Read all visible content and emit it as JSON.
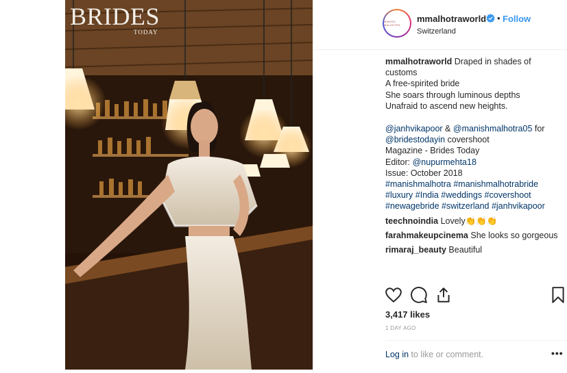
{
  "brand": {
    "title": "BRIDES",
    "subtitle": "TODAY"
  },
  "header": {
    "avatar_text": "MANISH MALHOTRA",
    "username": "mmalhotraworld",
    "dot": "•",
    "follow_label": "Follow",
    "location": "Switzerland"
  },
  "caption": {
    "username": "mmalhotraworld",
    "line1": "Draped in shades of customs",
    "line2": "A free-spirited bride",
    "line3": "She soars through luminous depths",
    "line4": "Unafraid to ascend new heights.",
    "credits1a": "@janhvikapoor",
    "credits1b": " & ",
    "credits1c": "@manishmalhotra05",
    "credits1d": " for",
    "credits2a": "@bridestodayin",
    "credits2b": " covershoot",
    "magazine": "Magazine - Brides Today",
    "editor_label": "Editor: ",
    "editor": "@nupurmehta18",
    "issue": "Issue: October 2018",
    "tags1": "#manishmalhotra #manishmalhotrabride",
    "tags2": "#luxury #India #weddings #covershoot",
    "tags3": "#newagebride #switzerland #janhvikapoor"
  },
  "comments": [
    {
      "user": "teechnoindia",
      "text": "Lovely👏👏👏"
    },
    {
      "user": "farahmakeupcinema",
      "text": "She looks so gorgeous"
    },
    {
      "user": "rimaraj_beauty",
      "text": "Beautiful"
    }
  ],
  "icons": [
    "heart-icon",
    "comment-icon",
    "share-icon",
    "bookmark-icon",
    "verified-icon"
  ],
  "likes": "3,417 likes",
  "timestamp": "1 DAY AGO",
  "footer": {
    "login": "Log in",
    "rest": " to like or comment.",
    "more": "•••"
  },
  "colors": {
    "link": "#003569",
    "follow": "#3897f0",
    "text": "#262626",
    "muted": "#999999"
  }
}
